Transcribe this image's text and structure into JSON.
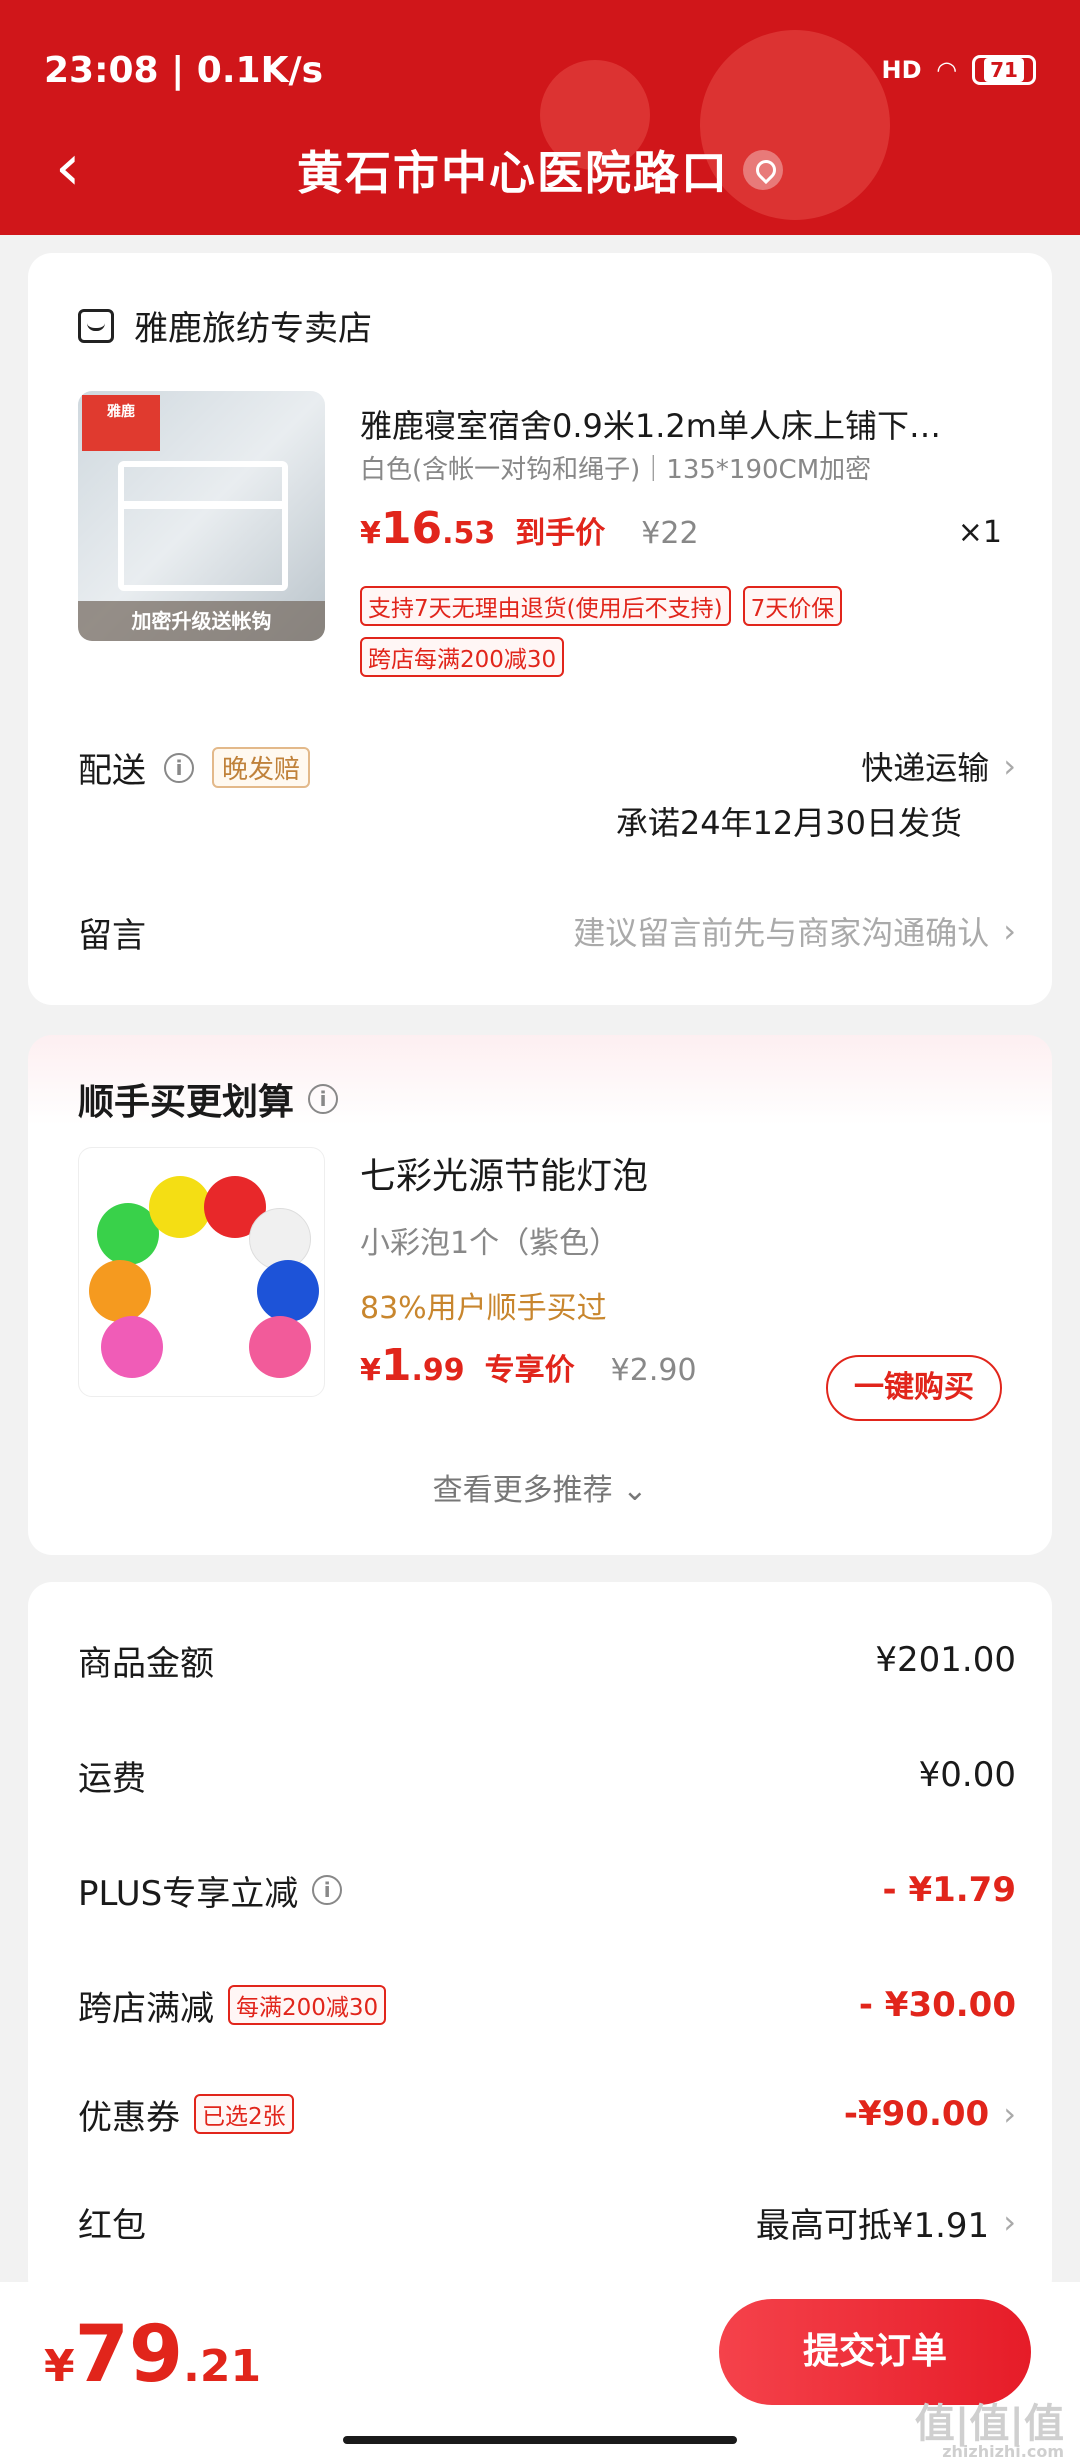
{
  "status_bar": {
    "time": "23:08 | 0.1K/s",
    "network": "HD",
    "battery": "71"
  },
  "header": {
    "title": "黄石市中心医院路口"
  },
  "order": {
    "store_name": "雅鹿旅纺专卖店",
    "product": {
      "image_logo": "雅鹿",
      "image_banner": "加密升级送帐钩",
      "name": "雅鹿寝室宿舍0.9米1.2m单人床上铺下…",
      "spec": "白色(含帐一对钩和绳子)｜135*190CM加密",
      "price_symbol": "¥",
      "price_int": "16",
      "price_dec": ".53",
      "price_label": "到手价",
      "original_price": "¥22",
      "quantity": "×1",
      "tags": [
        "支持7天无理由退货(使用后不支持)",
        "7天价保"
      ],
      "promo_tag": "跨店每满200减30"
    },
    "delivery": {
      "label": "配送",
      "badge": "晚发赔",
      "method": "快递运输",
      "promise": "承诺24年12月30日发货"
    },
    "message": {
      "label": "留言",
      "placeholder": "建议留言前先与商家沟通确认"
    }
  },
  "recommend": {
    "title": "顺手买更划算",
    "item": {
      "name": "七彩光源节能灯泡",
      "spec": "小彩泡1个（紫色）",
      "buy_stat": "83%用户顺手买过",
      "price_symbol": "¥",
      "price_int": "1",
      "price_dec": ".99",
      "price_label": "专享价",
      "original_price": "¥2.90",
      "buy_button": "一键购买"
    },
    "more_link": "查看更多推荐 ⌄"
  },
  "summary": {
    "goods_label": "商品金额",
    "goods_value": "¥201.00",
    "shipping_label": "运费",
    "shipping_value": "¥0.00",
    "plus_label": "PLUS专享立减",
    "plus_value": "- ¥1.79",
    "cross_label": "跨店满减",
    "cross_badge": "每满200减30",
    "cross_value": "- ¥30.00",
    "coupon_label": "优惠券",
    "coupon_badge": "已选2张",
    "coupon_value": "-¥90.00",
    "redpack_label": "红包",
    "redpack_value": "最高可抵¥1.91"
  },
  "bottom_bar": {
    "total_symbol": "¥",
    "total_int": "79",
    "total_dec": ".21",
    "submit_label": "提交订单"
  },
  "watermark": {
    "main": "值|值|值",
    "sub": "zhizhizhi.com"
  },
  "colors": {
    "brand_red": "#d0161a",
    "price_red": "#e1251b",
    "gold": "#c8862e"
  }
}
